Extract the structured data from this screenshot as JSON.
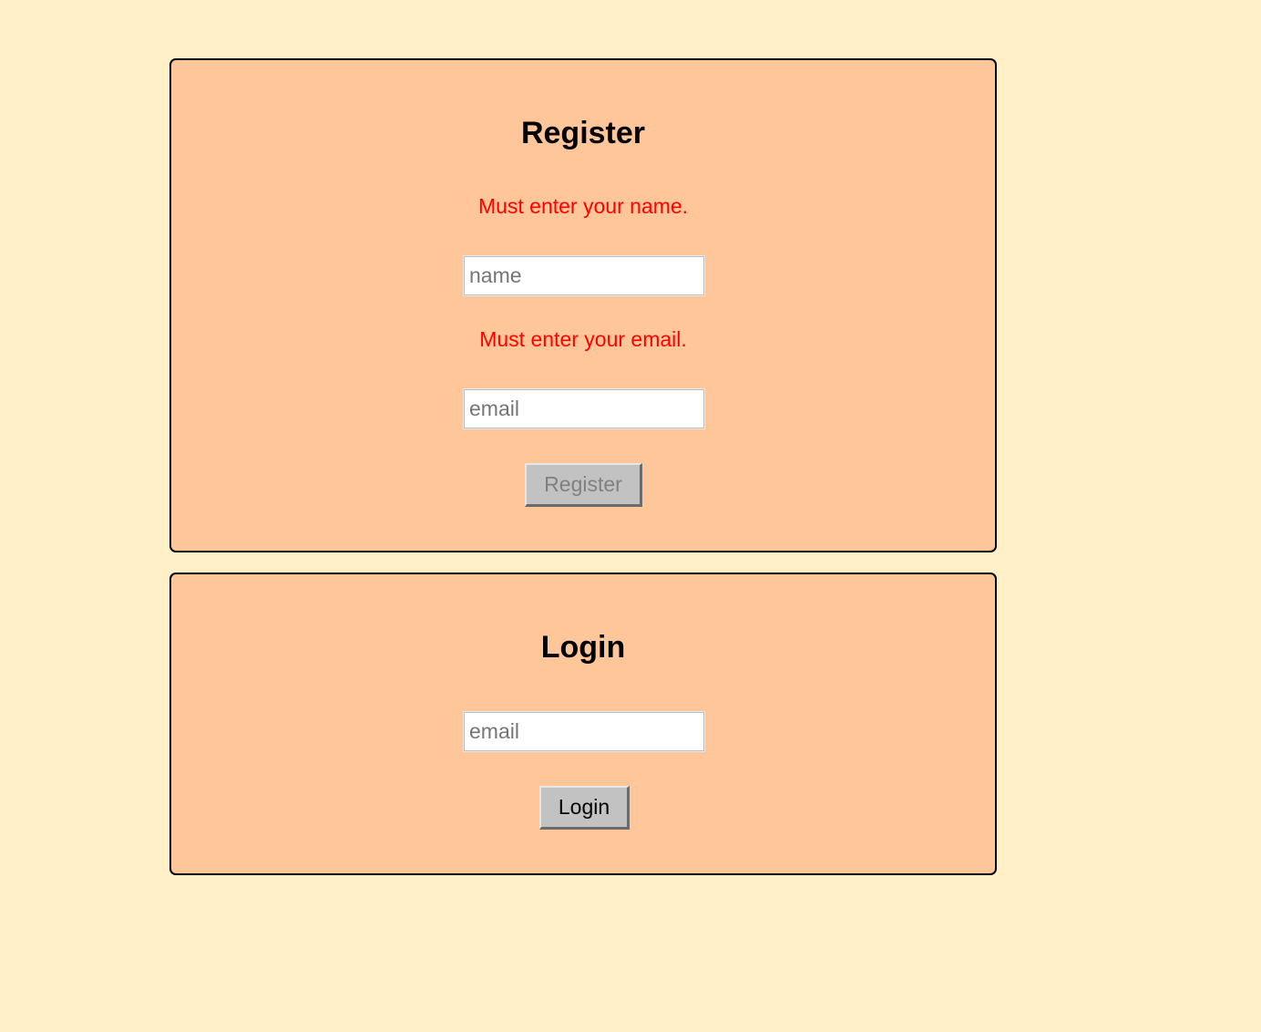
{
  "register": {
    "title": "Register",
    "name_error": "Must enter your name.",
    "name_placeholder": "name",
    "email_error": "Must enter your email.",
    "email_placeholder": "email",
    "button_label": "Register",
    "button_disabled": true
  },
  "login": {
    "title": "Login",
    "email_placeholder": "email",
    "button_label": "Login"
  },
  "colors": {
    "page_background": "#fff0c8",
    "panel_background": "#ffc699",
    "error_text": "#ff0000",
    "button_background": "#c2c2c2"
  }
}
